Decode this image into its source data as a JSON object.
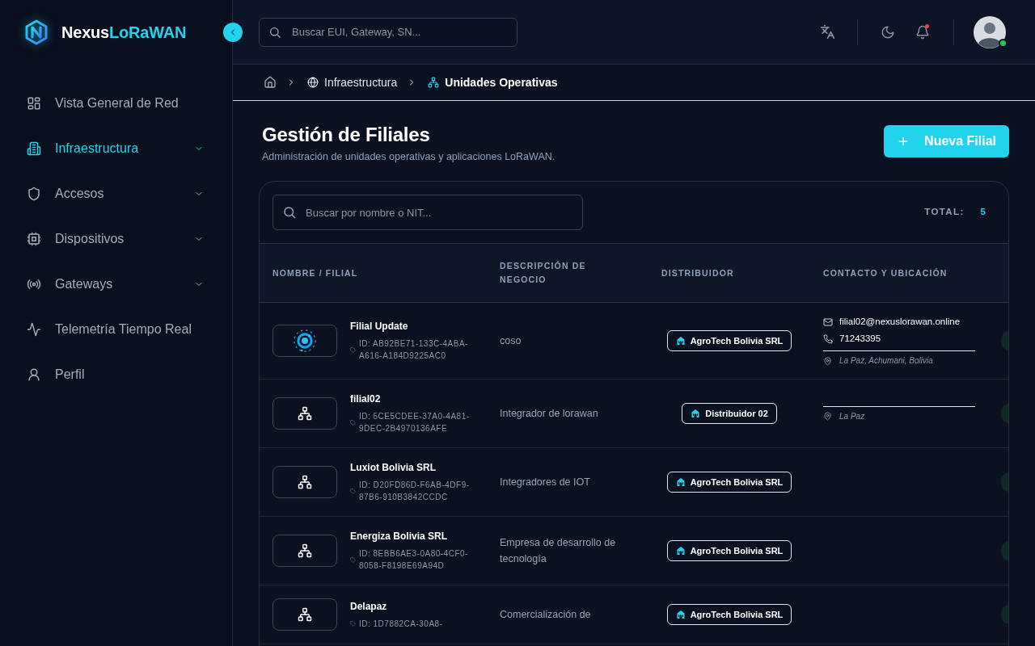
{
  "sidebar": {
    "brand": {
      "name": "Nexus",
      "name_accent": "LoRaWAN"
    },
    "items": [
      {
        "label": "Vista General de Red",
        "selected": false,
        "has_submenu": false
      },
      {
        "label": "Infraestructura",
        "selected": true,
        "has_submenu": true
      },
      {
        "label": "Accesos",
        "selected": false,
        "has_submenu": true
      },
      {
        "label": "Dispositivos",
        "selected": false,
        "has_submenu": true
      },
      {
        "label": "Gateways",
        "selected": false,
        "has_submenu": true
      },
      {
        "label": "Telemetría Tiempo Real",
        "selected": false,
        "has_submenu": false
      },
      {
        "label": "Perfil",
        "selected": false,
        "has_submenu": false
      }
    ]
  },
  "header": {
    "search": {
      "placeholder": "Buscar EUI, Gateway, SN..."
    },
    "notifications": {
      "unread": true
    },
    "user": {
      "online": true
    }
  },
  "breadcrumb": [
    {
      "label": "Infraestructura",
      "selected": false
    },
    {
      "label": "Unidades Operativas",
      "selected": true
    }
  ],
  "page": {
    "title": "Gestión de Filiales",
    "subtitle": "Administración de unidades operativas y aplicaciones LoRaWAN.",
    "primary_button": "Nueva Filial"
  },
  "table": {
    "search": {
      "placeholder": "Buscar por nombre o NIT..."
    },
    "total_label": "TOTAL:",
    "total": "5",
    "columns": [
      "NOMBRE / FILIAL",
      "DESCRIPCIÓN DE NEGOCIO",
      "DISTRIBUIDOR",
      "CONTACTO Y UBICACIÓN"
    ],
    "rows": [
      {
        "name": "Filial Update",
        "id": "ID: AB92BE71-133C-4ABA-A616-A184D9225AC0",
        "has_logo": true,
        "description": "coso",
        "distributor": "AgroTech Bolivia SRL",
        "contact": {
          "email": "filial02@nexuslorawan.online",
          "phone": "71243395",
          "location": "La Paz, Achumani, Bolivia"
        }
      },
      {
        "name": "filial02",
        "id": "ID: 5CE5CDEE-37A0-4A81-9DEC-2B4970136AFE",
        "has_logo": false,
        "description": "Integrador de lorawan",
        "distributor": "Distribuidor 02",
        "contact": {
          "location": "La Paz"
        }
      },
      {
        "name": "Luxiot Bolivia SRL",
        "id": "ID: D20FD86D-F6AB-4DF9-87B6-910B3842CCDC",
        "has_logo": false,
        "description": "Integradores de IOT",
        "distributor": "AgroTech Bolivia SRL"
      },
      {
        "name": "Energiza Bolivia SRL",
        "id": "ID: 8EBB6AE3-0A80-4CF0-8058-F8198E69A94D",
        "has_logo": false,
        "description": "Empresa de desarrollo de tecnología",
        "distributor": "AgroTech Bolivia SRL"
      },
      {
        "name": "Delapaz",
        "id": "ID: 1D7882CA-30A8-",
        "has_logo": false,
        "description": "Comercialización de",
        "distributor": "AgroTech Bolivia SRL"
      }
    ]
  }
}
